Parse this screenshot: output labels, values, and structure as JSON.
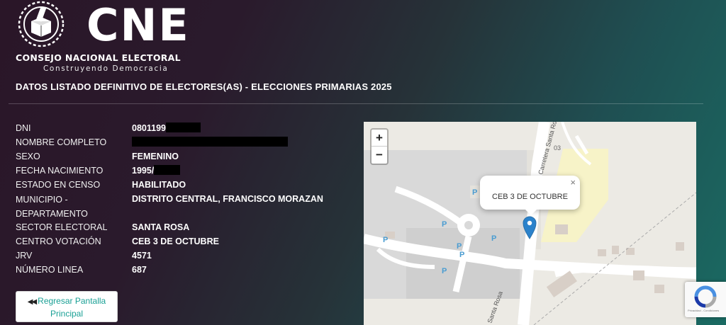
{
  "header": {
    "logo_text": "CNE",
    "org_name": "CONSEJO NACIONAL ELECTORAL",
    "slogan": "Construyendo Democracia",
    "page_title": "DATOS LISTADO DEFINITIVO DE ELECTORES(AS) - ELECCIONES PRIMARIAS 2025"
  },
  "elector": {
    "rows": [
      {
        "label": "DNI",
        "value": "0801199"
      },
      {
        "label": "NOMBRE COMPLETO",
        "value": ""
      },
      {
        "label": "SEXO",
        "value": "FEMENINO"
      },
      {
        "label": "FECHA NACIMIENTO",
        "value": "1995/"
      },
      {
        "label": "ESTADO EN CENSO",
        "value": "HABILITADO"
      },
      {
        "label": "MUNICIPIO - DEPARTAMENTO",
        "value": "DISTRITO CENTRAL, FRANCISCO MORAZAN"
      },
      {
        "label": "SECTOR ELECTORAL",
        "value": "SANTA ROSA"
      },
      {
        "label": "CENTRO VOTACIÓN",
        "value": "CEB 3 DE OCTUBRE"
      },
      {
        "label": "JRV",
        "value": "4571"
      },
      {
        "label": "NÚMERO LINEA",
        "value": "687"
      }
    ]
  },
  "actions": {
    "back_icon": "◀◀",
    "back_label": "Regresar Pantalla Principal"
  },
  "map": {
    "zoom_in": "+",
    "zoom_out": "−",
    "popup_text": "CEB 3 DE OCTUBRE",
    "popup_close": "×",
    "road_label_1": "Carretera Santa Rosa",
    "road_label_2": "Santa Rosa",
    "road_label_3": "03",
    "parking_label": "P",
    "marker_color": "#2b82cb"
  },
  "recaptcha": {
    "text": "Privacidad - Condiciones"
  }
}
